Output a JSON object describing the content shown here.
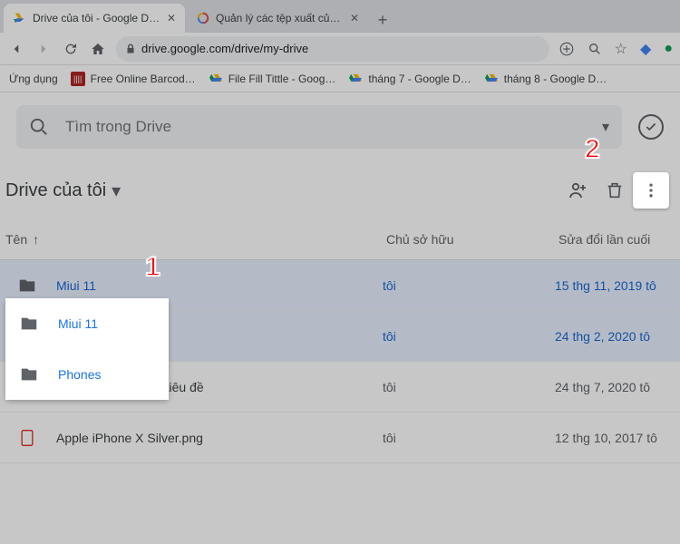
{
  "browser": {
    "tabs": [
      {
        "title": "Drive của tôi - Google Drive",
        "active": true
      },
      {
        "title": "Quản lý các tệp xuất của bạn",
        "active": false
      }
    ],
    "url": "drive.google.com/drive/my-drive",
    "bookmarks": [
      {
        "label": "Ứng dụng",
        "kind": "apps"
      },
      {
        "label": "Free Online Barcod…",
        "kind": "site"
      },
      {
        "label": "File Fill Tittle - Goog…",
        "kind": "gdrive"
      },
      {
        "label": "tháng 7 - Google D…",
        "kind": "gdrive"
      },
      {
        "label": "tháng 8 - Google D…",
        "kind": "gdrive"
      }
    ]
  },
  "search": {
    "placeholder": "Tìm trong Drive"
  },
  "drive_title": "Drive của tôi",
  "columns": {
    "name": "Tên",
    "owner": "Chủ sở hữu",
    "modified": "Sửa đổi lần cuối"
  },
  "files": [
    {
      "name": "Miui 11",
      "owner": "tôi",
      "modified": "15 thg 11, 2019  tô",
      "type": "folder",
      "selected": true
    },
    {
      "name": "Phones",
      "owner": "tôi",
      "modified": "24 thg 2, 2020  tô",
      "type": "folder",
      "selected": true
    },
    {
      "name": "Thư mục không có tiêu đề",
      "owner": "tôi",
      "modified": "24 thg 7, 2020  tô",
      "type": "folder",
      "selected": false
    },
    {
      "name": "Apple iPhone X Silver.png",
      "owner": "tôi",
      "modified": "12 thg 10, 2017  tô",
      "type": "image",
      "selected": false
    }
  ],
  "annotations": {
    "one": "1",
    "two": "2"
  }
}
